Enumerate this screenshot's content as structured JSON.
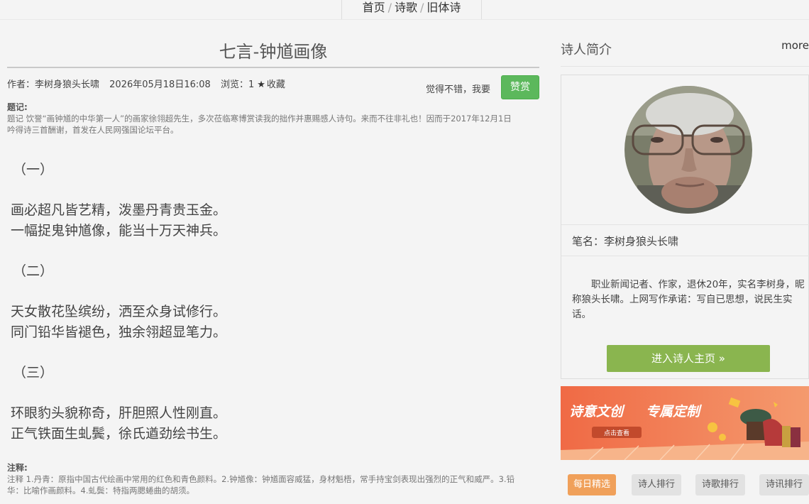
{
  "breadcrumb": {
    "home": "首页",
    "poetry": "诗歌",
    "category": "旧体诗",
    "separator": "/"
  },
  "article": {
    "title": "七言-钟馗画像",
    "author": "作者：李树身狼头长啸",
    "datetime": "2026年05月18日16:08",
    "views": "浏览：1",
    "favorite": "收藏",
    "reward_prompt": "觉得不错，我要",
    "reward_button": "赞赏",
    "preface_label": "题记:",
    "preface_line1": "题记 饮誉“画钟馗的中华第一人”的画家徐翎超先生，多次莅临寒博赏读我的拙作并惠赐感人诗句。来而不往非礼也！因而于2017年12月1日",
    "preface_line2": "吟得诗三首酬谢，首发在人民网强国论坛平台。",
    "poem": {
      "s1": "（一）",
      "l1": "画必超凡皆艺精，泼墨丹青贵玉金。",
      "l2": "一幅捉鬼钟馗像，能当十万天神兵。",
      "s2": "（二）",
      "l3": "天女散花坠缤纷，洒至众身试修行。",
      "l4": "同门铅华皆褪色，独余翎超显笔力。",
      "s3": "（三）",
      "l5": "环眼豹头貌称奇，肝胆照人性刚直。",
      "l6": "正气铁面生虬鬓，徐氏遒劲绘书生。"
    },
    "notes_label": "注释:",
    "notes_line1": "注释 1.丹青：原指中国古代绘画中常用的红色和青色颜料。2.钟馗像：钟馗面容威猛，身材魁梧，常手持宝剑表现出强烈的正气和威严。3.铅",
    "notes_line2": "华：比喻作画颜料。4.虬鬓：特指两腮蜷曲的胡须。"
  },
  "sidebar": {
    "title": "诗人简介",
    "more": "more",
    "pen_name": "笔名：李树身狼头长啸",
    "bio": "职业新闻记者、作家，退休20年，实名李树身，昵称狼头长啸。上网写作承诺：写自已思想，说民生实话。",
    "enter_button": "进入诗人主页 »",
    "banner_text1": "诗意文创",
    "banner_text2": "专属定制",
    "banner_button": "点击查看",
    "tabs": [
      "每日精选",
      "诗人排行",
      "诗歌排行",
      "诗讯排行"
    ]
  },
  "colors": {
    "reward": "#5cb85c",
    "enter": "#8ab54f",
    "active_tab": "#f0a05a",
    "banner": "#f26d4a"
  }
}
